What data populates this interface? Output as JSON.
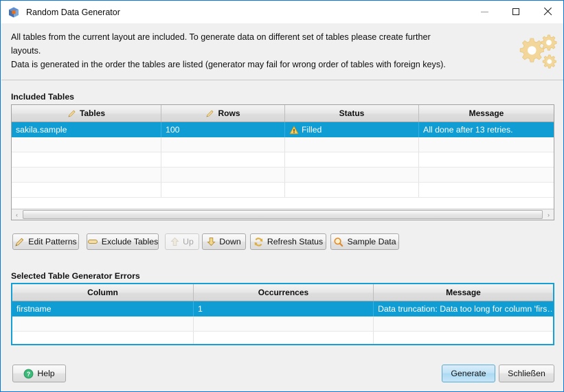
{
  "window": {
    "title": "Random Data Generator",
    "icon": "cube-icon",
    "controls": {
      "minimize": "minimize-button",
      "maximize": "maximize-button",
      "close": "close-button"
    },
    "accent_color": "#0a77d5",
    "selection_color": "#0f9dd4"
  },
  "header": {
    "line1": "All tables from the current layout are included. To generate data on different set of tables please create further",
    "line2": "layouts.",
    "line3": "Data is generated in the order the tables are listed (generator may fail for wrong order of tables with foreign keys).",
    "decoration_icon": "gears-icon",
    "decoration_color": "#f2d79a"
  },
  "included_tables": {
    "label": "Included Tables",
    "columns": [
      {
        "label": "Tables",
        "icon": "pencil-icon"
      },
      {
        "label": "Rows",
        "icon": "pencil-icon"
      },
      {
        "label": "Status",
        "icon": null
      },
      {
        "label": "Message",
        "icon": null
      }
    ],
    "rows": [
      {
        "tables": "sakila.sample",
        "rows": "100",
        "status": "Filled",
        "status_icon": "warning-icon",
        "message": "All done after 13 retries.",
        "selected": true
      },
      {
        "tables": "",
        "rows": "",
        "status": "",
        "status_icon": null,
        "message": "",
        "selected": false
      },
      {
        "tables": "",
        "rows": "",
        "status": "",
        "status_icon": null,
        "message": "",
        "selected": false
      },
      {
        "tables": "",
        "rows": "",
        "status": "",
        "status_icon": null,
        "message": "",
        "selected": false
      },
      {
        "tables": "",
        "rows": "",
        "status": "",
        "status_icon": null,
        "message": "",
        "selected": false
      }
    ],
    "scrollbar": {
      "left_arrow": "‹",
      "right_arrow": "›"
    }
  },
  "toolbar": {
    "edit_patterns": {
      "label": "Edit Patterns",
      "icon": "pencil-icon",
      "enabled": true
    },
    "exclude_tables": {
      "label": "Exclude Tables",
      "icon": "minus-pill-icon",
      "enabled": true
    },
    "up": {
      "label": "Up",
      "icon": "arrow-up-icon",
      "enabled": false
    },
    "down": {
      "label": "Down",
      "icon": "arrow-down-icon",
      "enabled": true
    },
    "refresh_status": {
      "label": "Refresh Status",
      "icon": "refresh-icon",
      "enabled": true
    },
    "sample_data": {
      "label": "Sample Data",
      "icon": "magnifier-icon",
      "enabled": true
    }
  },
  "errors": {
    "label": "Selected Table Generator Errors",
    "columns": [
      {
        "label": "Column"
      },
      {
        "label": "Occurrences"
      },
      {
        "label": "Message"
      }
    ],
    "rows": [
      {
        "column": "firstname",
        "occurrences": "1",
        "message": "Data truncation: Data too long for column 'firs…",
        "selected": true
      },
      {
        "column": "",
        "occurrences": "",
        "message": "",
        "selected": false
      },
      {
        "column": "",
        "occurrences": "",
        "message": "",
        "selected": false
      }
    ]
  },
  "footer": {
    "help": {
      "label": "Help",
      "icon": "help-icon",
      "color": "#3cb878"
    },
    "generate": {
      "label": "Generate"
    },
    "close": {
      "label": "Schließen"
    }
  }
}
